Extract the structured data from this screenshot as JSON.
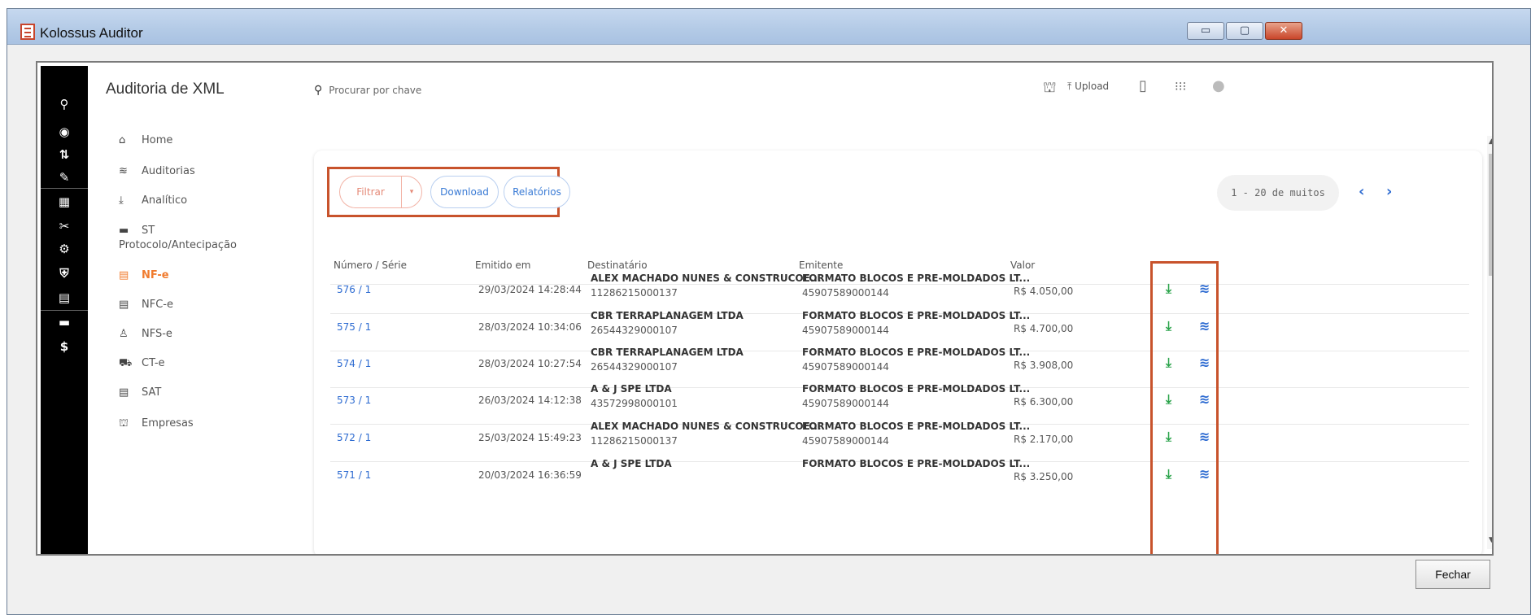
{
  "window": {
    "title": "Kolossus Auditor",
    "controls": [
      "▭",
      "▢",
      "✕"
    ]
  },
  "app": {
    "title": "Auditoria de XML",
    "search": {
      "placeholder": "Procurar por chave"
    },
    "top_actions": {
      "upload_label": "Upload"
    }
  },
  "rail_icons": [
    "search-icon",
    "eye-icon",
    "transfer-icon",
    "pencil-icon",
    "map-icon",
    "tools-icon",
    "gear-user-icon",
    "shield-icon",
    "clipboard-icon",
    "card-icon",
    "dollar-icon"
  ],
  "sidebar": {
    "items": [
      {
        "label": "Home",
        "icon": "home-icon"
      },
      {
        "label": "Auditorias",
        "icon": "database-icon"
      },
      {
        "label": "Analítico",
        "icon": "download-icon"
      },
      {
        "label": "ST Protocolo/Antecipação",
        "icon": "list-icon"
      },
      {
        "label": "NF-e",
        "icon": "invoice-icon",
        "active": true
      },
      {
        "label": "NFC-e",
        "icon": "invoice-icon"
      },
      {
        "label": "NFS-e",
        "icon": "user-icon"
      },
      {
        "label": "CT-e",
        "icon": "truck-icon"
      },
      {
        "label": "SAT",
        "icon": "invoice-icon"
      },
      {
        "label": "Empresas",
        "icon": "bank-icon"
      }
    ]
  },
  "toolbar": {
    "filter_label": "Filtrar",
    "download_label": "Download",
    "reports_label": "Relatórios"
  },
  "pagination": {
    "range": "1 - 20 de muitos"
  },
  "table": {
    "headers": {
      "numero": "Número / Série",
      "emitido": "Emitido em",
      "destinatario": "Destinatário",
      "emitente": "Emitente",
      "valor": "Valor"
    },
    "rows": [
      {
        "numero": "576 / 1",
        "emitido": "29/03/2024 14:28:44",
        "dest_nome": "ALEX MACHADO NUNES & CONSTRUCOE...",
        "dest_doc": "11286215000137",
        "emit_nome": "FORMATO BLOCOS E PRE-MOLDADOS LT...",
        "emit_doc": "45907589000144",
        "valor": "R$ 4.050,00"
      },
      {
        "numero": "575 / 1",
        "emitido": "28/03/2024 10:34:06",
        "dest_nome": "CBR TERRAPLANAGEM LTDA",
        "dest_doc": "26544329000107",
        "emit_nome": "FORMATO BLOCOS E PRE-MOLDADOS LT...",
        "emit_doc": "45907589000144",
        "valor": "R$ 4.700,00"
      },
      {
        "numero": "574 / 1",
        "emitido": "28/03/2024 10:27:54",
        "dest_nome": "CBR TERRAPLANAGEM LTDA",
        "dest_doc": "26544329000107",
        "emit_nome": "FORMATO BLOCOS E PRE-MOLDADOS LT...",
        "emit_doc": "45907589000144",
        "valor": "R$ 3.908,00"
      },
      {
        "numero": "573 / 1",
        "emitido": "26/03/2024 14:12:38",
        "dest_nome": "A & J SPE LTDA",
        "dest_doc": "43572998000101",
        "emit_nome": "FORMATO BLOCOS E PRE-MOLDADOS LT...",
        "emit_doc": "45907589000144",
        "valor": "R$ 6.300,00"
      },
      {
        "numero": "572 / 1",
        "emitido": "25/03/2024 15:49:23",
        "dest_nome": "ALEX MACHADO NUNES & CONSTRUCOE...",
        "dest_doc": "11286215000137",
        "emit_nome": "FORMATO BLOCOS E PRE-MOLDADOS LT...",
        "emit_doc": "45907589000144",
        "valor": "R$ 2.170,00"
      },
      {
        "numero": "571 / 1",
        "emitido": "20/03/2024 16:36:59",
        "dest_nome": "A & J SPE LTDA",
        "dest_doc": "",
        "emit_nome": "FORMATO BLOCOS E PRE-MOLDADOS LT...",
        "emit_doc": "",
        "valor": "R$ 3.250,00"
      }
    ]
  },
  "footer": {
    "close_label": "Fechar"
  },
  "colors": {
    "accent": "#f07b2e",
    "link": "#2d6bd1",
    "highlight_box": "#c8532c",
    "download_action": "#2aa34a"
  }
}
